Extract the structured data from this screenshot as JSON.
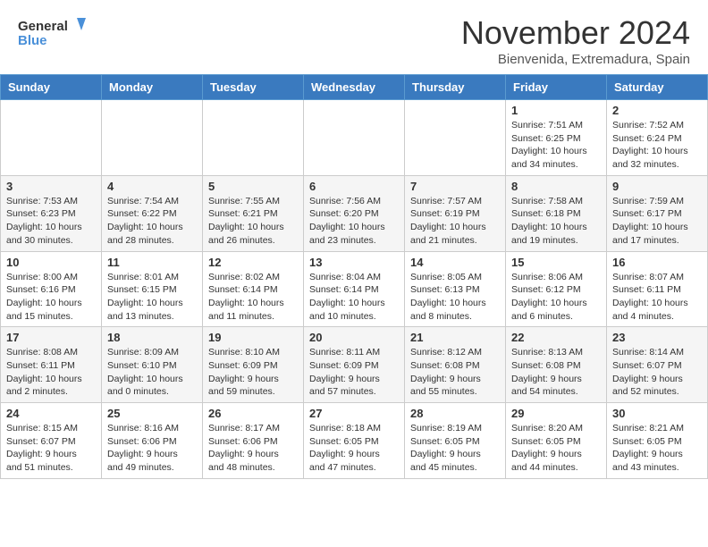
{
  "header": {
    "logo_line1": "General",
    "logo_line2": "Blue",
    "month": "November 2024",
    "location": "Bienvenida, Extremadura, Spain"
  },
  "weekdays": [
    "Sunday",
    "Monday",
    "Tuesday",
    "Wednesday",
    "Thursday",
    "Friday",
    "Saturday"
  ],
  "weeks": [
    [
      {
        "day": "",
        "info": ""
      },
      {
        "day": "",
        "info": ""
      },
      {
        "day": "",
        "info": ""
      },
      {
        "day": "",
        "info": ""
      },
      {
        "day": "",
        "info": ""
      },
      {
        "day": "1",
        "info": "Sunrise: 7:51 AM\nSunset: 6:25 PM\nDaylight: 10 hours\nand 34 minutes."
      },
      {
        "day": "2",
        "info": "Sunrise: 7:52 AM\nSunset: 6:24 PM\nDaylight: 10 hours\nand 32 minutes."
      }
    ],
    [
      {
        "day": "3",
        "info": "Sunrise: 7:53 AM\nSunset: 6:23 PM\nDaylight: 10 hours\nand 30 minutes."
      },
      {
        "day": "4",
        "info": "Sunrise: 7:54 AM\nSunset: 6:22 PM\nDaylight: 10 hours\nand 28 minutes."
      },
      {
        "day": "5",
        "info": "Sunrise: 7:55 AM\nSunset: 6:21 PM\nDaylight: 10 hours\nand 26 minutes."
      },
      {
        "day": "6",
        "info": "Sunrise: 7:56 AM\nSunset: 6:20 PM\nDaylight: 10 hours\nand 23 minutes."
      },
      {
        "day": "7",
        "info": "Sunrise: 7:57 AM\nSunset: 6:19 PM\nDaylight: 10 hours\nand 21 minutes."
      },
      {
        "day": "8",
        "info": "Sunrise: 7:58 AM\nSunset: 6:18 PM\nDaylight: 10 hours\nand 19 minutes."
      },
      {
        "day": "9",
        "info": "Sunrise: 7:59 AM\nSunset: 6:17 PM\nDaylight: 10 hours\nand 17 minutes."
      }
    ],
    [
      {
        "day": "10",
        "info": "Sunrise: 8:00 AM\nSunset: 6:16 PM\nDaylight: 10 hours\nand 15 minutes."
      },
      {
        "day": "11",
        "info": "Sunrise: 8:01 AM\nSunset: 6:15 PM\nDaylight: 10 hours\nand 13 minutes."
      },
      {
        "day": "12",
        "info": "Sunrise: 8:02 AM\nSunset: 6:14 PM\nDaylight: 10 hours\nand 11 minutes."
      },
      {
        "day": "13",
        "info": "Sunrise: 8:04 AM\nSunset: 6:14 PM\nDaylight: 10 hours\nand 10 minutes."
      },
      {
        "day": "14",
        "info": "Sunrise: 8:05 AM\nSunset: 6:13 PM\nDaylight: 10 hours\nand 8 minutes."
      },
      {
        "day": "15",
        "info": "Sunrise: 8:06 AM\nSunset: 6:12 PM\nDaylight: 10 hours\nand 6 minutes."
      },
      {
        "day": "16",
        "info": "Sunrise: 8:07 AM\nSunset: 6:11 PM\nDaylight: 10 hours\nand 4 minutes."
      }
    ],
    [
      {
        "day": "17",
        "info": "Sunrise: 8:08 AM\nSunset: 6:11 PM\nDaylight: 10 hours\nand 2 minutes."
      },
      {
        "day": "18",
        "info": "Sunrise: 8:09 AM\nSunset: 6:10 PM\nDaylight: 10 hours\nand 0 minutes."
      },
      {
        "day": "19",
        "info": "Sunrise: 8:10 AM\nSunset: 6:09 PM\nDaylight: 9 hours\nand 59 minutes."
      },
      {
        "day": "20",
        "info": "Sunrise: 8:11 AM\nSunset: 6:09 PM\nDaylight: 9 hours\nand 57 minutes."
      },
      {
        "day": "21",
        "info": "Sunrise: 8:12 AM\nSunset: 6:08 PM\nDaylight: 9 hours\nand 55 minutes."
      },
      {
        "day": "22",
        "info": "Sunrise: 8:13 AM\nSunset: 6:08 PM\nDaylight: 9 hours\nand 54 minutes."
      },
      {
        "day": "23",
        "info": "Sunrise: 8:14 AM\nSunset: 6:07 PM\nDaylight: 9 hours\nand 52 minutes."
      }
    ],
    [
      {
        "day": "24",
        "info": "Sunrise: 8:15 AM\nSunset: 6:07 PM\nDaylight: 9 hours\nand 51 minutes."
      },
      {
        "day": "25",
        "info": "Sunrise: 8:16 AM\nSunset: 6:06 PM\nDaylight: 9 hours\nand 49 minutes."
      },
      {
        "day": "26",
        "info": "Sunrise: 8:17 AM\nSunset: 6:06 PM\nDaylight: 9 hours\nand 48 minutes."
      },
      {
        "day": "27",
        "info": "Sunrise: 8:18 AM\nSunset: 6:05 PM\nDaylight: 9 hours\nand 47 minutes."
      },
      {
        "day": "28",
        "info": "Sunrise: 8:19 AM\nSunset: 6:05 PM\nDaylight: 9 hours\nand 45 minutes."
      },
      {
        "day": "29",
        "info": "Sunrise: 8:20 AM\nSunset: 6:05 PM\nDaylight: 9 hours\nand 44 minutes."
      },
      {
        "day": "30",
        "info": "Sunrise: 8:21 AM\nSunset: 6:05 PM\nDaylight: 9 hours\nand 43 minutes."
      }
    ]
  ]
}
